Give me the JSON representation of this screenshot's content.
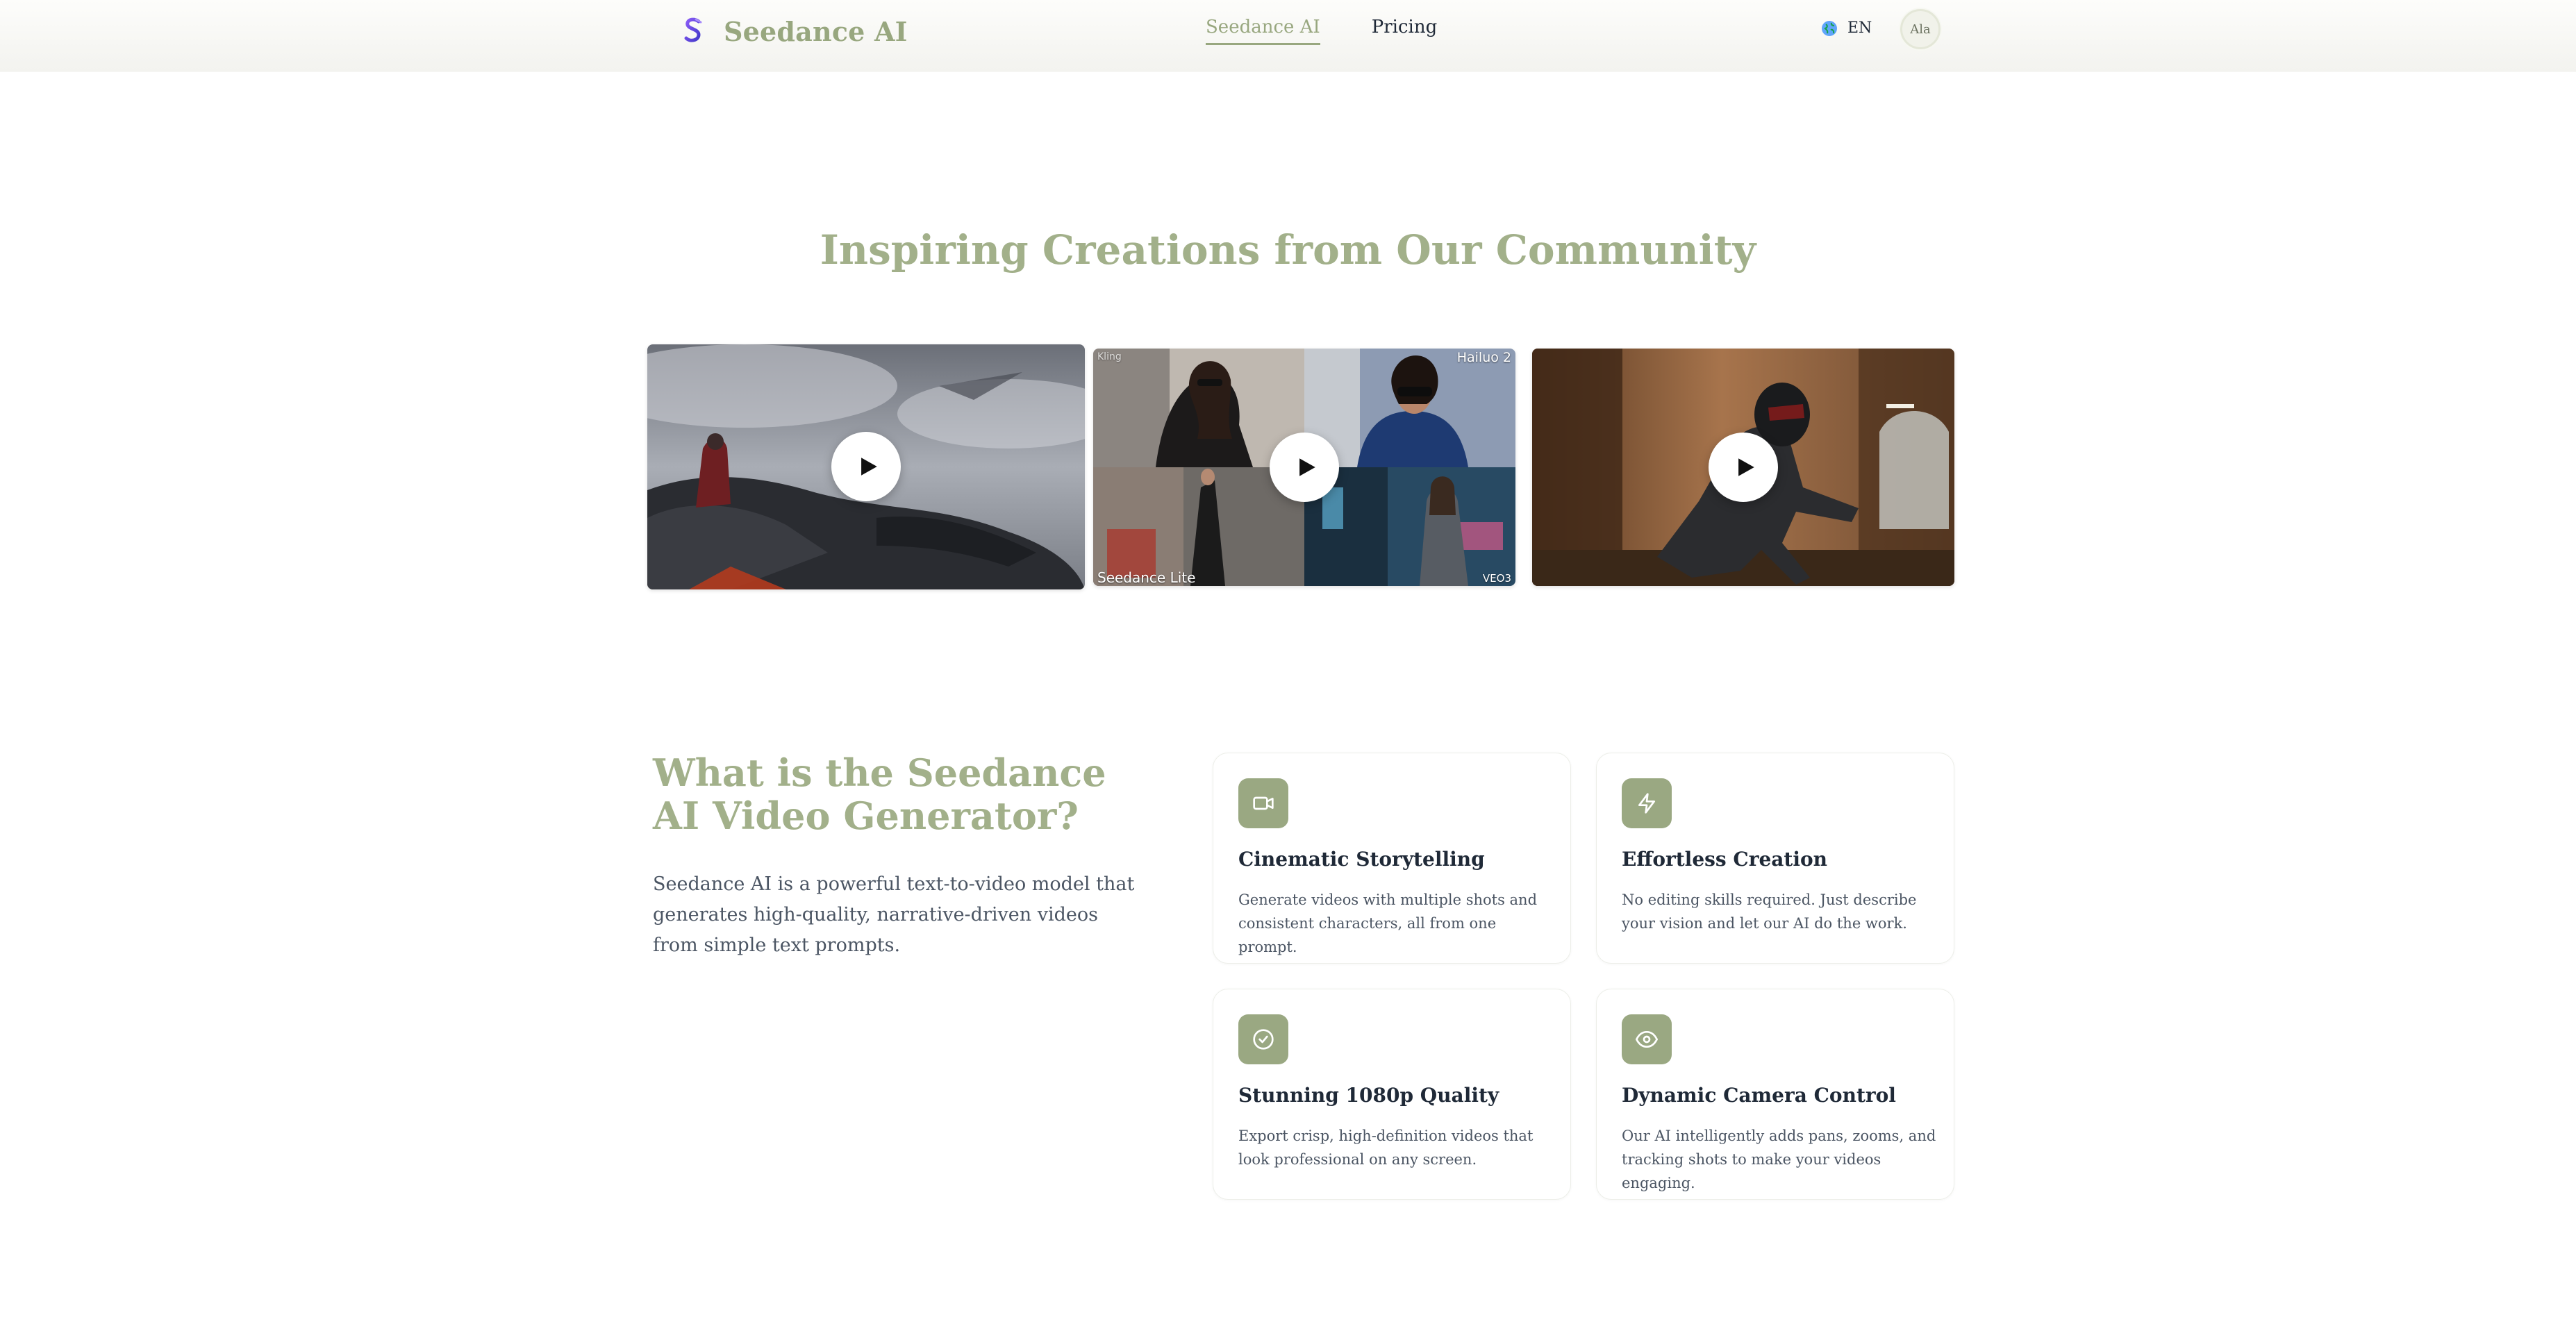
{
  "header": {
    "brand": "Seedance AI",
    "nav": [
      {
        "label": "Seedance AI",
        "active": true
      },
      {
        "label": "Pricing",
        "active": false
      }
    ],
    "language": "EN",
    "avatar_initials": "Ala"
  },
  "community": {
    "title": "Inspiring Creations from Our Community",
    "videos": [
      {
        "name": "dragon-rider-video",
        "tags": []
      },
      {
        "name": "model-comparison-video",
        "tags": [
          "Kling",
          "Hailuo 2",
          "Seedance Lite",
          "VEO3"
        ]
      },
      {
        "name": "running-man-video",
        "tags": []
      }
    ]
  },
  "about": {
    "title": "What is the Seedance AI Video Generator?",
    "description": "Seedance AI is a powerful text-to-video model that generates high-quality, narrative-driven videos from simple text prompts.",
    "features": [
      {
        "icon": "video-camera-icon",
        "title": "Cinematic Storytelling",
        "description": "Generate videos with multiple shots and consistent characters, all from one prompt."
      },
      {
        "icon": "lightning-icon",
        "title": "Effortless Creation",
        "description": "No editing skills required. Just describe your vision and let our AI do the work."
      },
      {
        "icon": "check-circle-icon",
        "title": "Stunning 1080p Quality",
        "description": "Export crisp, high-definition videos that look professional on any screen."
      },
      {
        "icon": "eye-icon",
        "title": "Dynamic Camera Control",
        "description": "Our AI intelligently adds pans, zooms, and tracking shots to make your videos engaging."
      }
    ]
  },
  "colors": {
    "accent": "#98a77f",
    "icon_bg": "#9aa882",
    "text": "#1f2937",
    "muted": "#4b5563"
  }
}
